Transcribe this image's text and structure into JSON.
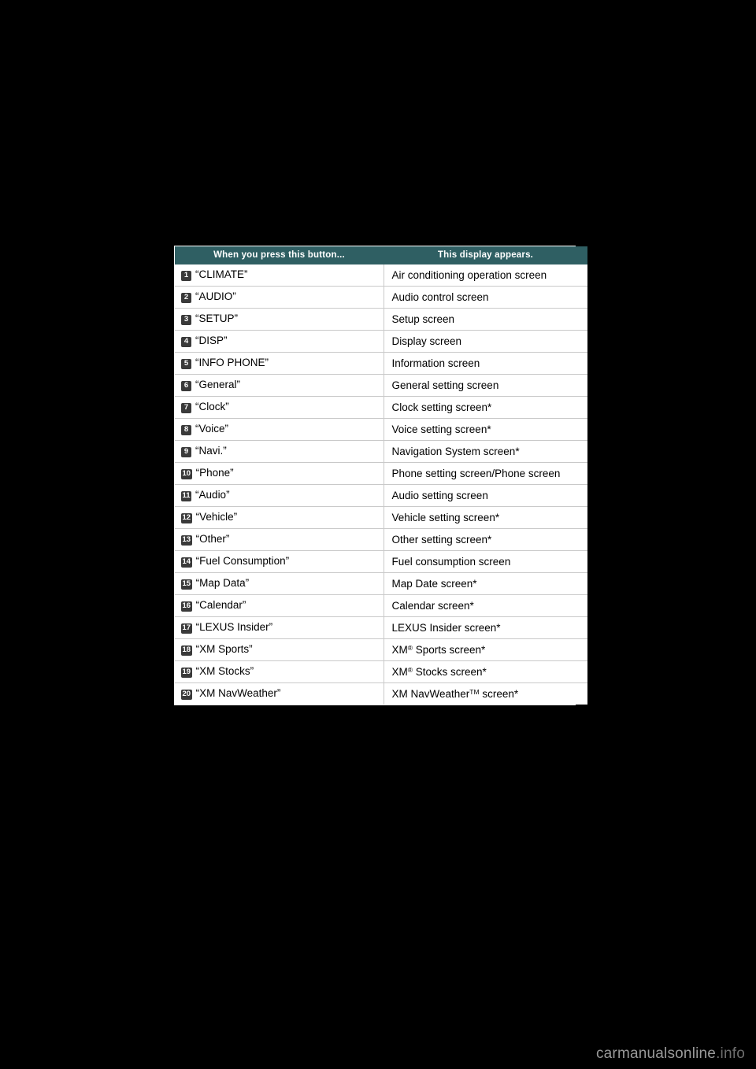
{
  "page": {
    "background_color": "#000000",
    "footer_brand_main": "carmanualsonline",
    "footer_brand_suffix": ".info"
  },
  "table": {
    "header": {
      "col1": "When you press this button...",
      "col2": "This display appears.",
      "background_color": "#2f5f63",
      "text_color": "#ffffff"
    },
    "rows": [
      {
        "num": "1",
        "button": "“CLIMATE”",
        "display": "Air conditioning operation screen"
      },
      {
        "num": "2",
        "button": "“AUDIO”",
        "display": "Audio control screen"
      },
      {
        "num": "3",
        "button": "“SETUP”",
        "display": "Setup screen"
      },
      {
        "num": "4",
        "button": "“DISP”",
        "display": "Display screen"
      },
      {
        "num": "5",
        "button": "“INFO PHONE”",
        "display": "Information screen"
      },
      {
        "num": "6",
        "button": "“General”",
        "display": "General setting screen"
      },
      {
        "num": "7",
        "button": "“Clock”",
        "display": "Clock setting screen*"
      },
      {
        "num": "8",
        "button": "“Voice”",
        "display": "Voice setting screen*"
      },
      {
        "num": "9",
        "button": "“Navi.”",
        "display": "Navigation System screen*"
      },
      {
        "num": "10",
        "button": "“Phone”",
        "display": "Phone setting screen/Phone screen"
      },
      {
        "num": "11",
        "button": "“Audio”",
        "display": "Audio setting screen"
      },
      {
        "num": "12",
        "button": "“Vehicle”",
        "display": "Vehicle setting screen*"
      },
      {
        "num": "13",
        "button": "“Other”",
        "display": "Other setting screen*"
      },
      {
        "num": "14",
        "button": "“Fuel Consumption”",
        "display": "Fuel consumption screen"
      },
      {
        "num": "15",
        "button": "“Map Data”",
        "display": "Map Date screen*"
      },
      {
        "num": "16",
        "button": "“Calendar”",
        "display": "Calendar screen*"
      },
      {
        "num": "17",
        "button": "“LEXUS Insider”",
        "display": "LEXUS Insider screen*"
      },
      {
        "num": "18",
        "button": "“XM Sports”",
        "display_pre": "XM",
        "display_sup": "®",
        "display_post": " Sports screen*"
      },
      {
        "num": "19",
        "button": "“XM Stocks”",
        "display_pre": "XM",
        "display_sup": "®",
        "display_post": " Stocks screen*"
      },
      {
        "num": "20",
        "button": "“XM NavWeather”",
        "display_pre": "XM NavWeather",
        "display_sup": "TM",
        "display_post": " screen*"
      }
    ]
  }
}
